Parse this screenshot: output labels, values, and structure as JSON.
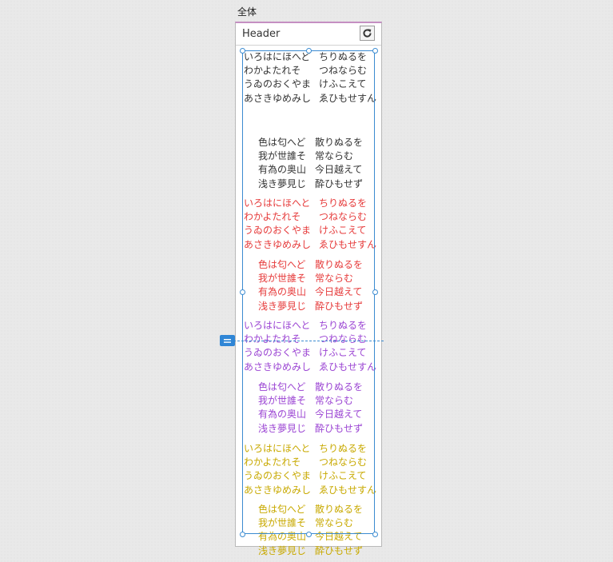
{
  "frame": {
    "label": "全体",
    "header_title": "Header"
  },
  "icons": {
    "refresh": "refresh-icon",
    "guide": "equals-icon"
  },
  "colors": {
    "black": "#333333",
    "red": "#e63b3b",
    "purple": "#9b45d3",
    "yellow": "#c8a900",
    "selection": "#3b8bd1",
    "frame_top": "#c58fc2"
  },
  "blocks": [
    {
      "a": [
        [
          "いろはにほへど",
          "ちりぬるを"
        ],
        [
          "わかよたれそ",
          "つねならむ"
        ],
        [
          "うゐのおくやま",
          "けふこえて"
        ],
        [
          "あさきゆめみし",
          "ゑひもせすん"
        ]
      ],
      "b": [
        [
          "色は匂へど",
          "散りぬるを"
        ],
        [
          "我が世誰そ",
          "常ならむ"
        ],
        [
          "有為の奥山",
          "今日越えて"
        ],
        [
          "浅き夢見じ",
          "酔ひもせず"
        ]
      ]
    },
    {
      "a": [
        [
          "いろはにほへと",
          "ちりぬるを"
        ],
        [
          "わかよたれそ",
          "つねならむ"
        ],
        [
          "うゐのおくやま",
          "けふこえて"
        ],
        [
          "あさきゆめみし",
          "ゑひもせすん"
        ]
      ],
      "b": [
        [
          "色は匂へど",
          "散りぬるを"
        ],
        [
          "我が世誰そ",
          "常ならむ"
        ],
        [
          "有為の奥山",
          "今日越えて"
        ],
        [
          "浅き夢見じ",
          "酔ひもせず"
        ]
      ]
    },
    {
      "a": [
        [
          "いろはにほへと",
          "ちりぬるを"
        ],
        [
          "わかよたれそ",
          "つねならむ"
        ],
        [
          "うゐのおくやま",
          "けふこえて"
        ],
        [
          "あさきゆめみし",
          "ゑひもせすん"
        ]
      ],
      "b": [
        [
          "色は匂へど",
          "散りぬるを"
        ],
        [
          "我が世誰そ",
          "常ならむ"
        ],
        [
          "有為の奥山",
          "今日越えて"
        ],
        [
          "浅き夢見じ",
          "酔ひもせず"
        ]
      ]
    },
    {
      "a": [
        [
          "いろはにほへと",
          "ちりぬるを"
        ],
        [
          "わかよたれそ",
          "つねならむ"
        ],
        [
          "うゐのおくやま",
          "けふこえて"
        ],
        [
          "あさきゆめみし",
          "ゑひもせすん"
        ]
      ],
      "b": [
        [
          "色は匂へど",
          "散りぬるを"
        ],
        [
          "我が世誰そ",
          "常ならむ"
        ],
        [
          "有為の奥山",
          "今日越えて"
        ],
        [
          "浅き夢見じ",
          "酔ひもせず"
        ]
      ]
    }
  ]
}
